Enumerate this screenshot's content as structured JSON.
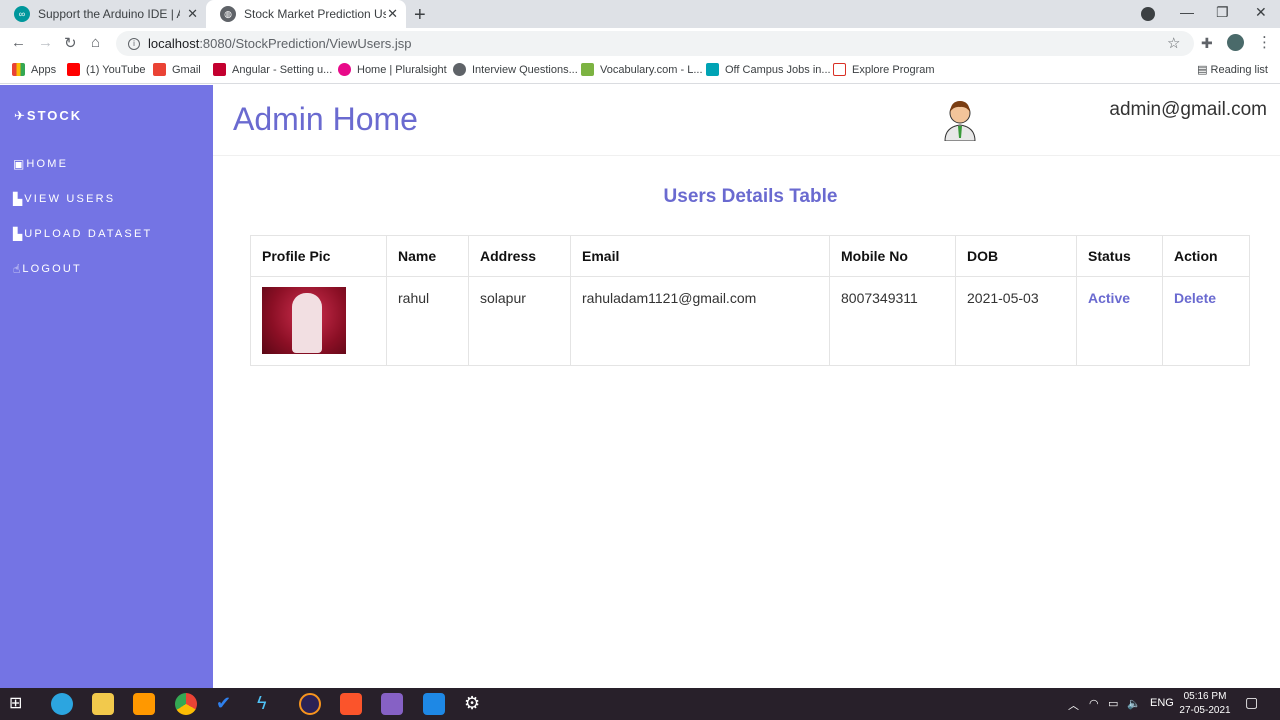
{
  "browser": {
    "tabs": [
      {
        "title": "Support the Arduino IDE | Arduino",
        "active": false
      },
      {
        "title": "Stock Market Prediction Using Ma",
        "active": true
      }
    ],
    "url_host": "localhost",
    "url_path": ":8080/StockPrediction/ViewUsers.jsp",
    "bookmarks": [
      {
        "label": "Apps",
        "color": "#e94235"
      },
      {
        "label": "(1) YouTube",
        "color": "#ff0000"
      },
      {
        "label": "Gmail",
        "color": "#ea4335"
      },
      {
        "label": "Angular - Setting u...",
        "color": "#c3002f"
      },
      {
        "label": "Home | Pluralsight",
        "color": "#e80a89"
      },
      {
        "label": "Interview Questions...",
        "color": "#5f6368"
      },
      {
        "label": "Vocabulary.com - L...",
        "color": "#7cb342"
      },
      {
        "label": "Off Campus Jobs in...",
        "color": "#00a3b4"
      },
      {
        "label": "Explore Program",
        "color": "#d93025"
      }
    ],
    "reading_list": "Reading list"
  },
  "sidebar": {
    "brand": "STOCK",
    "items": [
      {
        "label": "HOME",
        "icon": "calendar-icon"
      },
      {
        "label": "VIEW USERS",
        "icon": "bar-chart-icon"
      },
      {
        "label": "UPLOAD DATASET",
        "icon": "bar-chart-icon"
      },
      {
        "label": "LOGOUT",
        "icon": "hand-pointer-icon"
      }
    ]
  },
  "header": {
    "title": "Admin Home",
    "email": "admin@gmail.com"
  },
  "table": {
    "title": "Users Details Table",
    "columns": [
      "Profile Pic",
      "Name",
      "Address",
      "Email",
      "Mobile No",
      "DOB",
      "Status",
      "Action"
    ],
    "rows": [
      {
        "name": "rahul",
        "address": "solapur",
        "email": "rahuladam1121@gmail.com",
        "mobile": "8007349311",
        "dob": "2021-05-03",
        "status": "Active",
        "action": "Delete"
      }
    ]
  },
  "taskbar": {
    "language": "ENG",
    "time": "05:16 PM",
    "date": "27-05-2021"
  },
  "colors": {
    "sidebar": "#7474e4",
    "accent": "#6a6ad0"
  }
}
